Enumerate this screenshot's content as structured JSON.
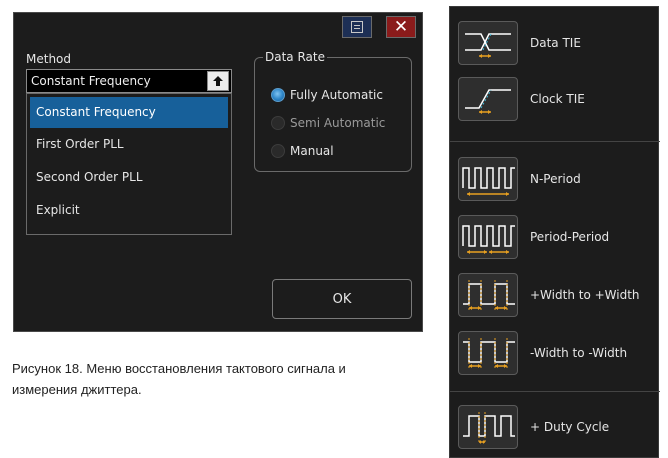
{
  "dialog": {
    "close_glyph": "✕",
    "method_label": "Method",
    "method_value": "Constant Frequency",
    "method_options": [
      "Constant Frequency",
      "First Order PLL",
      "Second Order PLL",
      "Explicit"
    ],
    "data_rate": {
      "legend": "Data Rate",
      "options": [
        "Fully Automatic",
        "Semi Automatic",
        "Manual"
      ],
      "selected": "Fully Automatic"
    },
    "ok_label": "OK"
  },
  "caption": "Рисунок 18. Меню восстановления тактового сигнала и измерения джиттера.",
  "measurements": {
    "items": [
      {
        "label": "Data TIE",
        "icon": "data-tie-icon"
      },
      {
        "label": "Clock TIE",
        "icon": "clock-tie-icon"
      },
      {
        "label": "N-Period",
        "icon": "n-period-icon"
      },
      {
        "label": "Period-Period",
        "icon": "period-period-icon"
      },
      {
        "label": "+Width to +Width",
        "icon": "pos-width-icon"
      },
      {
        "label": "-Width to -Width",
        "icon": "neg-width-icon"
      },
      {
        "label": "+ Duty Cycle",
        "icon": "duty-cycle-icon"
      }
    ]
  },
  "colors": {
    "dialog_bg": "#1c1c1c",
    "selected_item": "#17609a",
    "close_button": "#8a1b1b",
    "menu_button": "#1d2f55",
    "accent_orange": "#e8a020",
    "accent_cyan": "#3fb8d8"
  }
}
